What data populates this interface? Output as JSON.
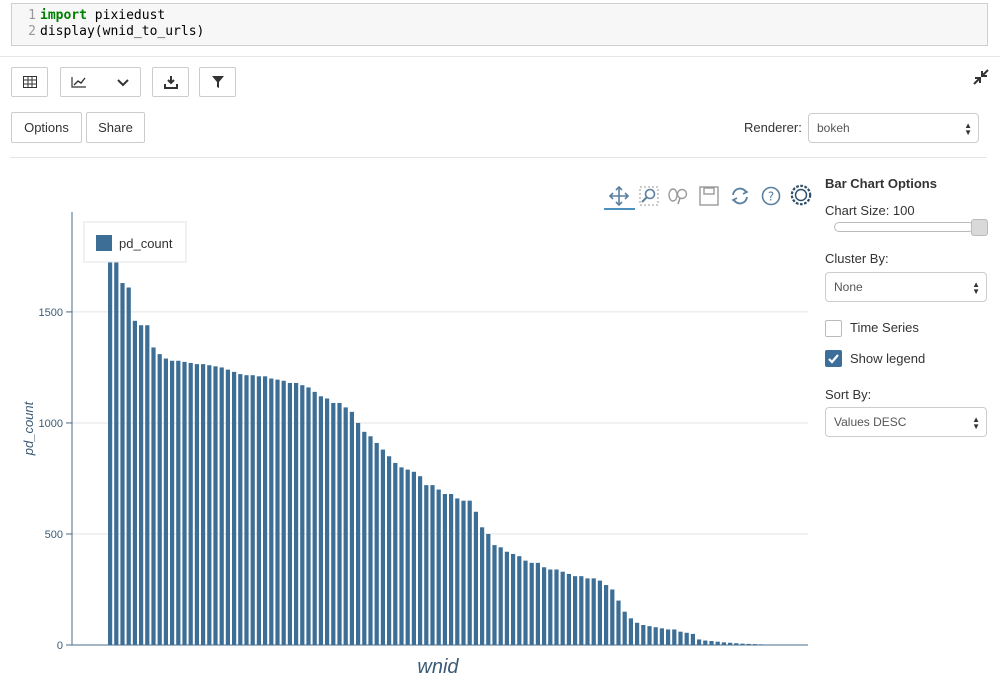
{
  "code": {
    "lines": [
      {
        "num": "1",
        "keyword": "import",
        "text": " pixiedust"
      },
      {
        "num": "2",
        "keyword": "",
        "text": "display(wnid_to_urls)"
      }
    ]
  },
  "toolbar": {
    "buttons": [
      "table-icon",
      "line-chart-icon",
      "chevron-down-icon",
      "download-icon",
      "filter-icon"
    ],
    "collapse_icon": "collapse-arrows-icon"
  },
  "actions": {
    "options_label": "Options",
    "share_label": "Share"
  },
  "renderer": {
    "label": "Renderer:",
    "value": "bokeh"
  },
  "bokeh_tools": [
    "pan-icon",
    "box-zoom-icon",
    "wheel-zoom-icon",
    "save-icon",
    "reset-icon",
    "help-icon",
    "bokeh-logo-icon"
  ],
  "panel": {
    "title": "Bar Chart Options",
    "chart_size_label": "Chart Size: 100",
    "chart_size_value": 100,
    "cluster_by_label": "Cluster By:",
    "cluster_by_value": "None",
    "time_series_label": "Time Series",
    "time_series_checked": false,
    "show_legend_label": "Show legend",
    "show_legend_checked": true,
    "sort_by_label": "Sort By:",
    "sort_by_value": "Values DESC"
  },
  "chart_data": {
    "type": "bar",
    "xlabel": "wnid",
    "ylabel": "pd_count",
    "legend": [
      "pd_count"
    ],
    "legend_position": "top-left",
    "bar_color": "#3d6e96",
    "grid": true,
    "ylim": [
      0,
      1950
    ],
    "yticks": [
      0,
      500,
      1000,
      1500
    ],
    "values": [
      1730,
      1730,
      1630,
      1610,
      1460,
      1440,
      1440,
      1340,
      1310,
      1290,
      1280,
      1280,
      1275,
      1270,
      1265,
      1265,
      1260,
      1255,
      1250,
      1240,
      1230,
      1220,
      1215,
      1215,
      1210,
      1210,
      1200,
      1195,
      1190,
      1180,
      1180,
      1170,
      1160,
      1140,
      1120,
      1110,
      1090,
      1090,
      1070,
      1050,
      1000,
      960,
      940,
      910,
      880,
      850,
      820,
      800,
      790,
      780,
      760,
      720,
      720,
      700,
      680,
      680,
      660,
      650,
      650,
      600,
      530,
      500,
      450,
      440,
      420,
      410,
      400,
      380,
      370,
      370,
      350,
      340,
      340,
      330,
      320,
      310,
      310,
      300,
      300,
      290,
      270,
      250,
      200,
      150,
      120,
      100,
      90,
      85,
      80,
      75,
      70,
      70,
      60,
      55,
      50,
      25,
      20,
      18,
      15,
      12,
      10,
      8,
      6,
      5,
      4,
      3,
      2,
      2,
      1,
      1
    ]
  }
}
